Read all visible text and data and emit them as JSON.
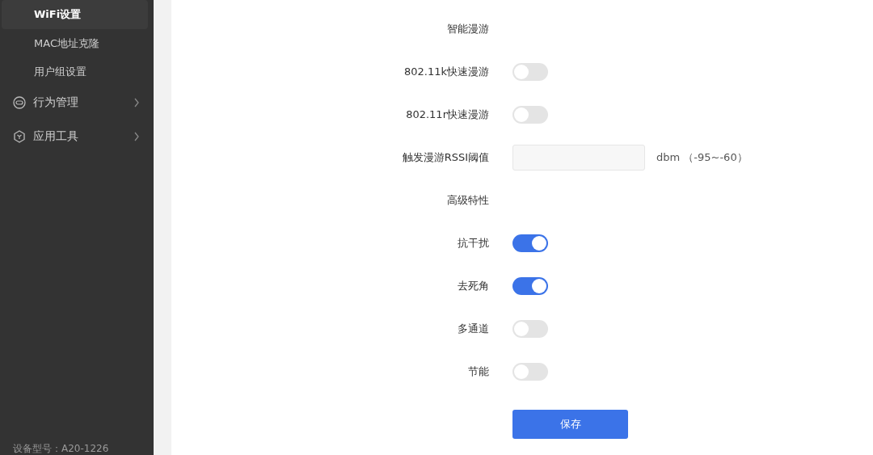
{
  "sidebar": {
    "items": [
      {
        "label": "WiFi设置",
        "kind": "sub",
        "selected": true
      },
      {
        "label": "MAC地址克隆",
        "kind": "sub",
        "selected": false
      },
      {
        "label": "用户组设置",
        "kind": "sub",
        "selected": false
      },
      {
        "label": "行为管理",
        "kind": "group",
        "expanded": false
      },
      {
        "label": "应用工具",
        "kind": "group",
        "expanded": false
      }
    ],
    "footer": "设备型号：A20-1226"
  },
  "form": {
    "rows": [
      {
        "kind": "heading",
        "label": "智能漫游"
      },
      {
        "kind": "toggle",
        "label": "802.11k快速漫游",
        "on": false
      },
      {
        "kind": "toggle",
        "label": "802.11r快速漫游",
        "on": false
      },
      {
        "kind": "input",
        "label": "触发漫游RSSI阈值",
        "unit": "dbm （-95~-60）"
      },
      {
        "kind": "heading",
        "label": "高级特性"
      },
      {
        "kind": "toggle",
        "label": "抗干扰",
        "on": true
      },
      {
        "kind": "toggle",
        "label": "去死角",
        "on": true
      },
      {
        "kind": "toggle",
        "label": "多通道",
        "on": false
      },
      {
        "kind": "toggle",
        "label": "节能",
        "on": false
      }
    ],
    "save_button": "保存"
  }
}
